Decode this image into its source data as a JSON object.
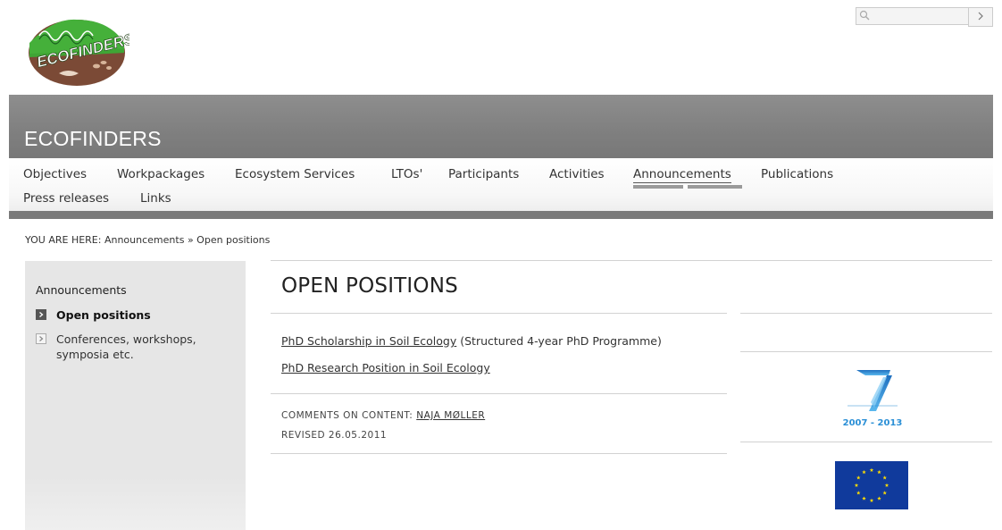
{
  "header": {
    "logo_text": "ECOFINDERS",
    "site_title": "ECOFINDERS",
    "search_placeholder": "",
    "search_submit_glyph": ">"
  },
  "nav": {
    "items": [
      {
        "label": "Objectives"
      },
      {
        "label": "Workpackages"
      },
      {
        "label": "Ecosystem Services"
      },
      {
        "label": "LTOs'"
      },
      {
        "label": "Participants"
      },
      {
        "label": "Activities"
      },
      {
        "label": "Announcements",
        "active": true
      },
      {
        "label": "Publications"
      },
      {
        "label": "Press releases"
      },
      {
        "label": "Links"
      }
    ]
  },
  "breadcrumb": {
    "prefix": "YOU ARE HERE:",
    "items": [
      "Announcements",
      "Open positions"
    ],
    "separator": "»"
  },
  "sidebar": {
    "heading": "Announcements",
    "items": [
      {
        "label": "Open positions",
        "active": true
      },
      {
        "label": "Conferences, workshops, symposia etc.",
        "active": false
      }
    ]
  },
  "main": {
    "heading": "OPEN POSITIONS",
    "positions": [
      {
        "link_text": "PhD Scholarship in Soil Ecology",
        "note": " (Structured 4-year PhD Programme)"
      },
      {
        "link_text": "PhD Research Position in Soil Ecology",
        "note": ""
      }
    ],
    "comments_label": "COMMENTS ON CONTENT:",
    "comments_contact": "NAJA MØLLER",
    "revised": "REVISED 26.05.2011"
  },
  "right_column": {
    "fp7_years": "2007 - 2013",
    "fp7_numeral": "7"
  },
  "colors": {
    "banner": "#808080",
    "nav_bar": "#7a7a7a",
    "sidebar_bg": "#e6e6e6",
    "logo_green": "#3fa535",
    "logo_brown": "#7b4a36",
    "fp7_blue": "#2a8fd6",
    "eu_blue": "#103a9c",
    "eu_gold": "#ffdd00"
  }
}
